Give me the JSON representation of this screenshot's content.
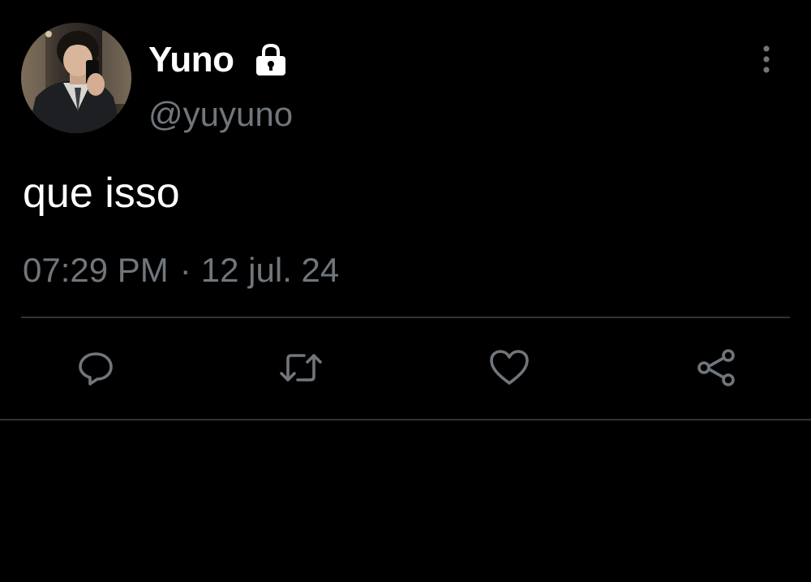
{
  "tweet": {
    "author": {
      "display_name": "Yuno",
      "handle": "@yuyuno",
      "protected": true,
      "avatar": "profile-photo"
    },
    "text": "que isso",
    "time": "07:29 PM",
    "separator": "·",
    "date": "12 jul. 24"
  },
  "actions": [
    {
      "name": "reply",
      "icon": "speech-bubble-icon"
    },
    {
      "name": "retweet",
      "icon": "retweet-icon"
    },
    {
      "name": "like",
      "icon": "heart-icon"
    },
    {
      "name": "share",
      "icon": "share-icon"
    }
  ],
  "colors": {
    "background": "#000000",
    "primary_text": "#ffffff",
    "secondary_text": "#71767b",
    "divider": "#2f3336",
    "icon": "#71767b"
  }
}
